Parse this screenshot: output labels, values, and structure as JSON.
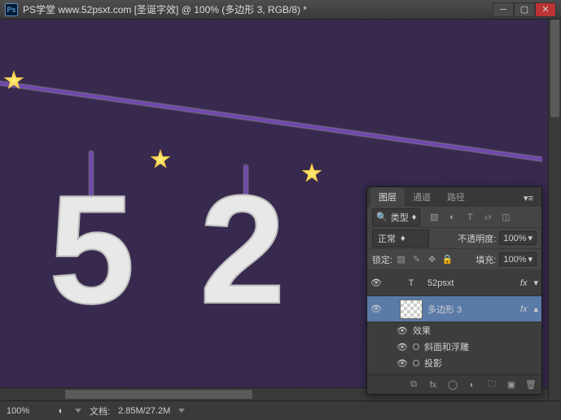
{
  "titlebar": {
    "app_icon": "Ps",
    "title": "PS学堂  www.52psxt.com [圣诞字效] @ 100% (多边形 3, RGB/8) *"
  },
  "statusbar": {
    "zoom": "100%",
    "doc_label": "文档:",
    "doc_size": "2.85M/27.2M"
  },
  "panel": {
    "tabs": {
      "layers": "图层",
      "channels": "通道",
      "paths": "路径"
    },
    "filter_kind": "类型",
    "blend_mode": "正常",
    "opacity_label": "不透明度:",
    "opacity_value": "100%",
    "lock_label": "锁定:",
    "fill_label": "填充:",
    "fill_value": "100%",
    "layer1_name": "52psxt",
    "layer2_name": "多边形 3",
    "effects_label": "效果",
    "bevel_label": "斜面和浮雕",
    "shadow_label": "投影",
    "fx_label": "fx"
  }
}
